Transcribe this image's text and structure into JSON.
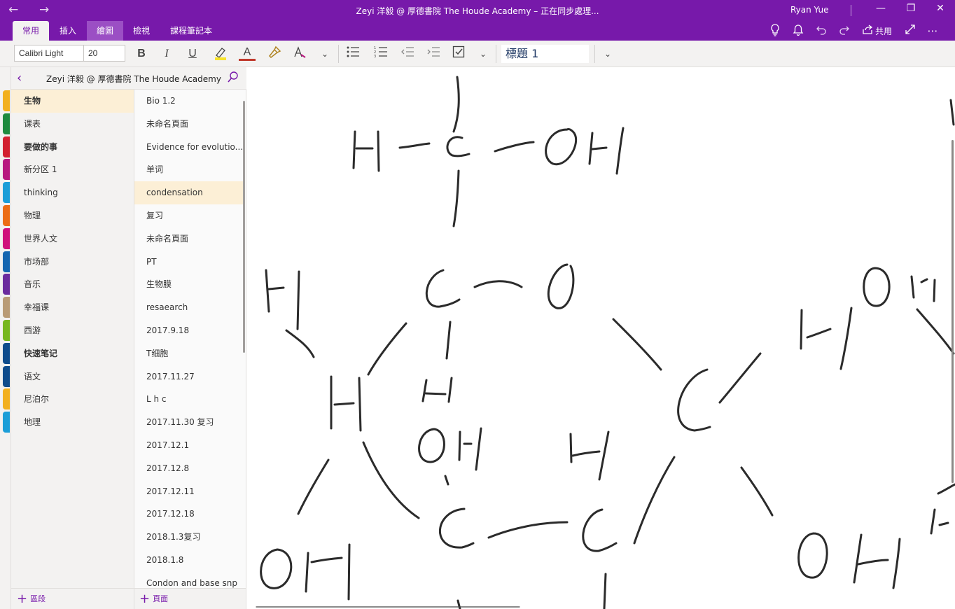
{
  "window": {
    "title": "Zeyi 洋毅 @ 厚德書院 The Houde Academy – 正在同步處理...",
    "user": "Ryan Yue"
  },
  "ribbon": {
    "tabs": [
      "常用",
      "插入",
      "繪圖",
      "檢視",
      "課程筆記本"
    ],
    "share_label": "共用"
  },
  "toolbar": {
    "font_name": "Calibri Light",
    "font_size": "20",
    "bold": "B",
    "italic": "I",
    "underline": "U",
    "font_color": "A",
    "style": "標題 1"
  },
  "notebook": {
    "title": "Zeyi 洋毅 @ 厚德書院 The Houde Academy"
  },
  "sections": [
    {
      "label": "生物",
      "color": "#f2b01e",
      "bold": true,
      "active": true
    },
    {
      "label": "课表",
      "color": "#1e8a3e",
      "bold": false
    },
    {
      "label": "要做的事",
      "color": "#d21f2f",
      "bold": true
    },
    {
      "label": "新分区 1",
      "color": "#b8187f",
      "bold": false
    },
    {
      "label": "thinking",
      "color": "#1b9ed8",
      "bold": false
    },
    {
      "label": "物理",
      "color": "#ec6c14",
      "bold": false
    },
    {
      "label": "世界人文",
      "color": "#d0107c",
      "bold": false
    },
    {
      "label": "市场部",
      "color": "#1566b0",
      "bold": false
    },
    {
      "label": "音乐",
      "color": "#6b2b9e",
      "bold": false
    },
    {
      "label": "幸福课",
      "color": "#b99b76",
      "bold": false
    },
    {
      "label": "西游",
      "color": "#77b71e",
      "bold": false
    },
    {
      "label": "快速笔记",
      "color": "#0f4c8c",
      "bold": true
    },
    {
      "label": "语文",
      "color": "#0f4c8c",
      "bold": false
    },
    {
      "label": "尼泊尔",
      "color": "#f2b01e",
      "bold": false
    },
    {
      "label": "地理",
      "color": "#1b9ed8",
      "bold": false
    }
  ],
  "pages": [
    {
      "label": "Bio 1.2"
    },
    {
      "label": "未命名頁面"
    },
    {
      "label": "Evidence for evolutio..."
    },
    {
      "label": "单词"
    },
    {
      "label": "condensation",
      "active": true
    },
    {
      "label": "复习"
    },
    {
      "label": "未命名頁面"
    },
    {
      "label": "PT"
    },
    {
      "label": "生物膜"
    },
    {
      "label": "resaearch"
    },
    {
      "label": "2017.9.18"
    },
    {
      "label": "T细胞"
    },
    {
      "label": "2017.11.27"
    },
    {
      "label": "L h c"
    },
    {
      "label": "2017.11.30 复习"
    },
    {
      "label": "2017.12.1"
    },
    {
      "label": "2017.12.8"
    },
    {
      "label": "2017.12.11"
    },
    {
      "label": "2017.12.18"
    },
    {
      "label": "2018.1.3复习"
    },
    {
      "label": "2018.1.8"
    },
    {
      "label": "Condon and base snp"
    }
  ],
  "bottom": {
    "add_section": "區段",
    "add_page": "頁面"
  }
}
